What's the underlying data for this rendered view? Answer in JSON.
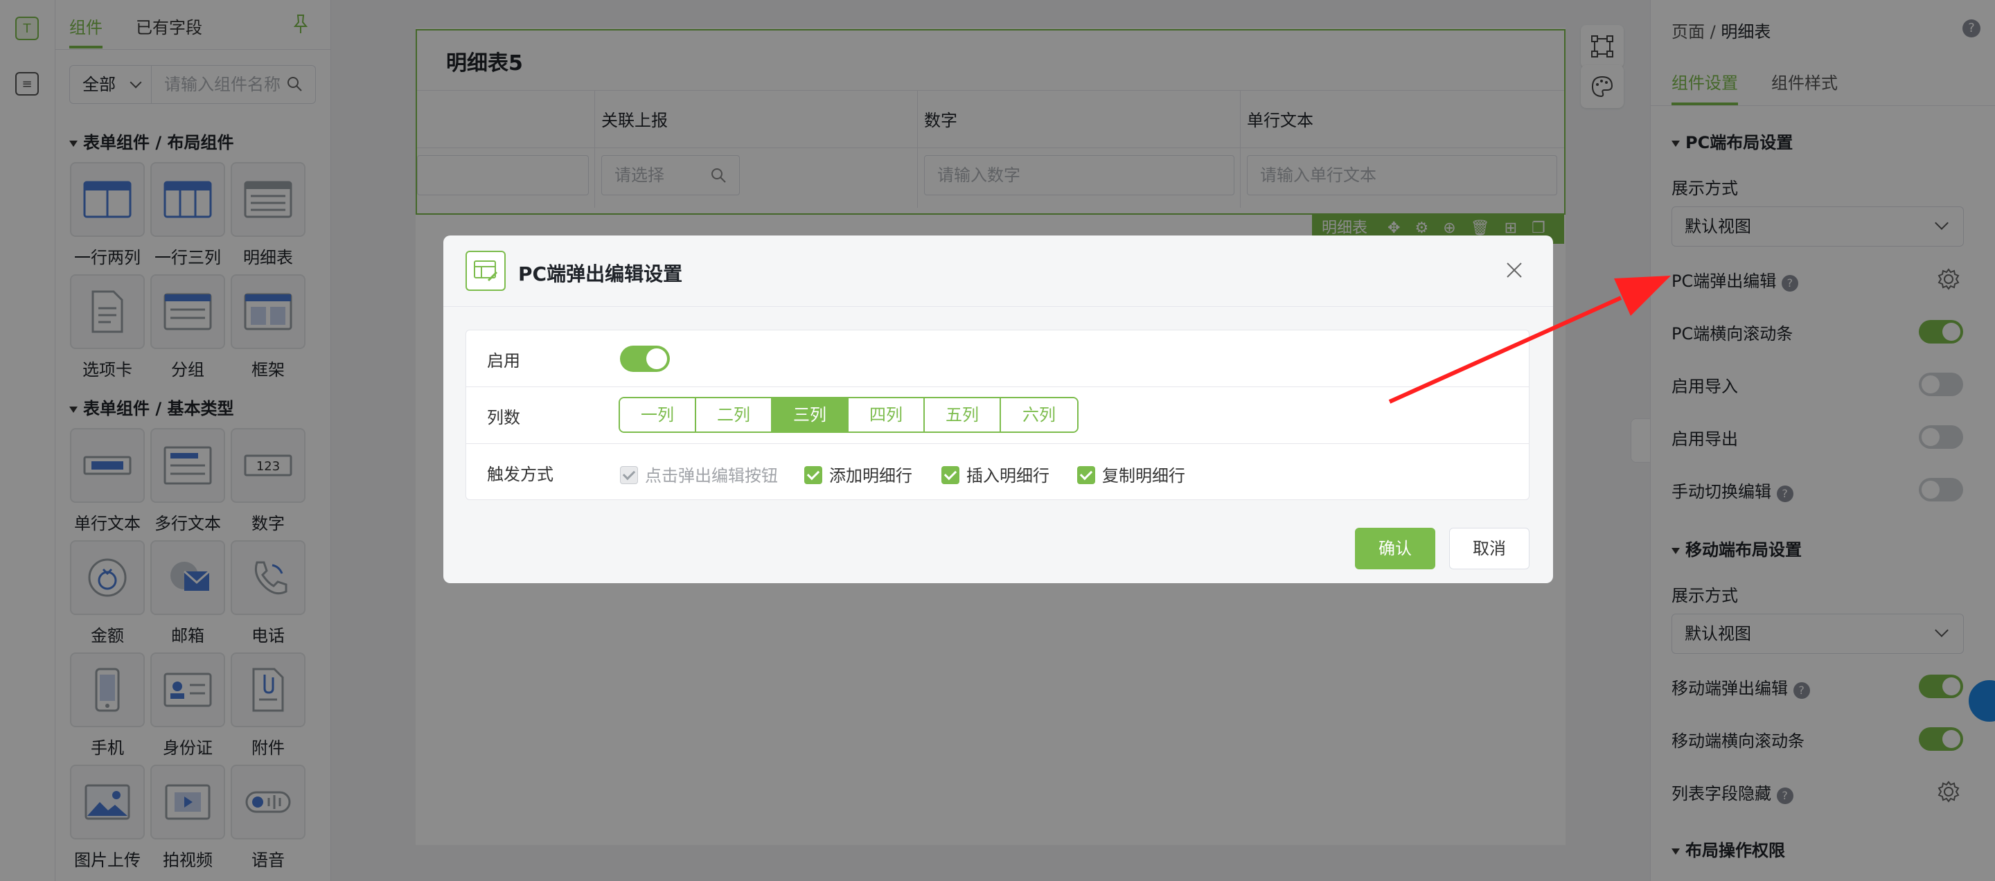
{
  "left_tabs": {
    "components": "组件",
    "fields": "已有字段"
  },
  "filter": {
    "selected": "全部",
    "placeholder": "请输入组件名称"
  },
  "groups": [
    {
      "title": "表单组件 / 布局组件",
      "items": [
        "一行两列",
        "一行三列",
        "明细表",
        "选项卡",
        "分组",
        "框架"
      ]
    },
    {
      "title": "表单组件 / 基本类型",
      "items": [
        "单行文本",
        "多行文本",
        "数字",
        "金额",
        "邮箱",
        "电话",
        "手机",
        "身份证",
        "附件",
        "图片上传",
        "拍视频",
        "语音"
      ]
    }
  ],
  "canvas": {
    "detail_title": "明细表5",
    "columns": [
      "关联上报",
      "数字",
      "单行文本"
    ],
    "inputs": {
      "relate": "请选择",
      "number": "请输入数字",
      "text": "请输入单行文本"
    },
    "toolbar_label": "明细表"
  },
  "right": {
    "breadcrumb_root": "页面",
    "breadcrumb_sep": "/",
    "breadcrumb_current": "明细表",
    "tabs": [
      "组件设置",
      "组件样式"
    ],
    "pc_section": "PC端布局设置",
    "display_mode_label": "展示方式",
    "display_mode_value": "默认视图",
    "pc_popup_edit": "PC端弹出编辑",
    "pc_hscroll": "PC端横向滚动条",
    "enable_import": "启用导入",
    "enable_export": "启用导出",
    "manual_switch_edit": "手动切换编辑",
    "mobile_section": "移动端布局设置",
    "mobile_display_label": "展示方式",
    "mobile_display_value": "默认视图",
    "mobile_popup_edit": "移动端弹出编辑",
    "mobile_hscroll": "移动端横向滚动条",
    "list_hide": "列表字段隐藏",
    "perm_section": "布局操作权限",
    "help_glyph": "?"
  },
  "modal": {
    "title": "PC端弹出编辑设置",
    "enable_label": "启用",
    "columns_label": "列数",
    "column_options": [
      "一列",
      "二列",
      "三列",
      "四列",
      "五列",
      "六列"
    ],
    "selected_column": "三列",
    "trigger_label": "触发方式",
    "triggers": [
      "点击弹出编辑按钮",
      "添加明细行",
      "插入明细行",
      "复制明细行"
    ],
    "confirm": "确认",
    "cancel": "取消"
  },
  "colors": {
    "accent": "#7cbc4c",
    "arrow": "#ff2020"
  }
}
